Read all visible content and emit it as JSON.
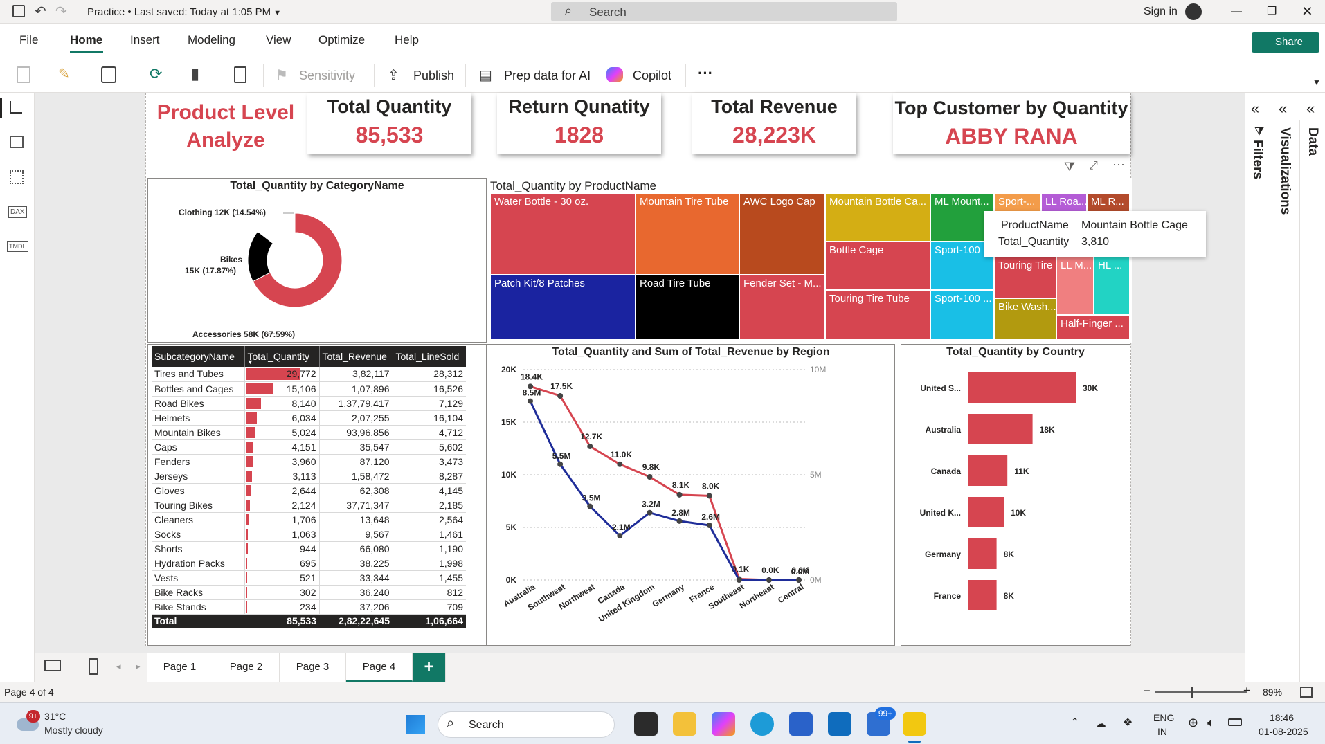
{
  "titlebar": {
    "file_name": "Practice",
    "saved_status": "Last saved: Today at 1:05 PM",
    "search_placeholder": "Search",
    "sign_in": "Sign in"
  },
  "menu": {
    "items": [
      "File",
      "Home",
      "Insert",
      "Modeling",
      "View",
      "Optimize",
      "Help"
    ],
    "active": "Home",
    "share_label": "Share"
  },
  "ribbon": {
    "sensitivity": "Sensitivity",
    "publish": "Publish",
    "prep_data": "Prep data for AI",
    "copilot": "Copilot",
    "more": "···"
  },
  "panes": {
    "filters": "Filters",
    "visualizations": "Visualizations",
    "data": "Data"
  },
  "report": {
    "title_line1": "Product Level",
    "title_line2": "Analyze",
    "kpis": [
      {
        "title": "Total Quantity",
        "value": "85,533"
      },
      {
        "title": "Return Qunatity",
        "value": "1828"
      },
      {
        "title": "Total Revenue",
        "value": "28,223K"
      },
      {
        "title": "Top Customer by Quantity",
        "value": "ABBY RANA"
      }
    ]
  },
  "donut": {
    "title": "Total_Quantity by CategoryName",
    "labels": [
      "Clothing 12K (14.54%)",
      "Bikes",
      "15K (17.87%)",
      "Accessories 58K (67.59%)"
    ],
    "chart_data": {
      "type": "pie",
      "categories": [
        "Accessories",
        "Bikes",
        "Clothing"
      ],
      "values": [
        67.59,
        17.87,
        14.54
      ],
      "colors": [
        "#d64550",
        "#000000",
        "#ffffff"
      ]
    }
  },
  "treemap": {
    "title": "Total_Quantity by ProductName",
    "tiles": [
      "Water Bottle - 30 oz.",
      "Mountain Tire Tube",
      "AWC Logo Cap",
      "Mountain Bottle Ca...",
      "ML Mount...",
      "Sport-...",
      "LL Roa...",
      "ML R...",
      "Patch Kit/8 Patches",
      "Road Tire Tube",
      "Fender Set - M...",
      "Bottle Cage",
      "Sport-100 ...",
      "Touring Tire",
      "LL M...",
      "HL ...",
      "Touring Tire Tube",
      "Sport-100 ...",
      "Bike Wash...",
      "Half-Finger ..."
    ],
    "tooltip": {
      "k1": "ProductName",
      "v1": "Mountain Bottle Cage",
      "k2": "Total_Quantity",
      "v2": "3,810"
    }
  },
  "matrix": {
    "headers": [
      "SubcategoryName",
      "Total_Quantity",
      "Total_Revenue",
      "Total_LineSold"
    ],
    "rows": [
      [
        "Tires and Tubes",
        "29,772",
        "3,82,117",
        "28,312"
      ],
      [
        "Bottles and Cages",
        "15,106",
        "1,07,896",
        "16,526"
      ],
      [
        "Road Bikes",
        "8,140",
        "1,37,79,417",
        "7,129"
      ],
      [
        "Helmets",
        "6,034",
        "2,07,255",
        "16,104"
      ],
      [
        "Mountain Bikes",
        "5,024",
        "93,96,856",
        "4,712"
      ],
      [
        "Caps",
        "4,151",
        "35,547",
        "5,602"
      ],
      [
        "Fenders",
        "3,960",
        "87,120",
        "3,473"
      ],
      [
        "Jerseys",
        "3,113",
        "1,58,472",
        "8,287"
      ],
      [
        "Gloves",
        "2,644",
        "62,308",
        "4,145"
      ],
      [
        "Touring Bikes",
        "2,124",
        "37,71,347",
        "2,185"
      ],
      [
        "Cleaners",
        "1,706",
        "13,648",
        "2,564"
      ],
      [
        "Socks",
        "1,063",
        "9,567",
        "1,461"
      ],
      [
        "Shorts",
        "944",
        "66,080",
        "1,190"
      ],
      [
        "Hydration Packs",
        "695",
        "38,225",
        "1,998"
      ],
      [
        "Vests",
        "521",
        "33,344",
        "1,455"
      ],
      [
        "Bike Racks",
        "302",
        "36,240",
        "812"
      ],
      [
        "Bike Stands",
        "234",
        "37,206",
        "709"
      ]
    ],
    "total": [
      "Total",
      "85,533",
      "2,82,22,645",
      "1,06,664"
    ],
    "quantities": [
      29772,
      15106,
      8140,
      6034,
      5024,
      4151,
      3960,
      3113,
      2644,
      2124,
      1706,
      1063,
      944,
      695,
      521,
      302,
      234
    ]
  },
  "region_chart": {
    "title": "Total_Quantity and Sum of Total_Revenue by Region",
    "chart_data": {
      "type": "line",
      "categories": [
        "Australia",
        "Southwest",
        "Northwest",
        "Canada",
        "United Kingdom",
        "Germany",
        "France",
        "Southeast",
        "Northeast",
        "Central"
      ],
      "series": [
        {
          "name": "Total_Quantity",
          "axis": "left",
          "color": "#d64550",
          "values": [
            18.4,
            17.5,
            12.7,
            11.0,
            9.8,
            8.1,
            8.0,
            0.1,
            0.0,
            0.0
          ],
          "labels": [
            "18.4K",
            "17.5K",
            "12.7K",
            "11.0K",
            "9.8K",
            "8.1K",
            "8.0K",
            "0.1K",
            "0.0K",
            "0.0K"
          ]
        },
        {
          "name": "Sum of Total_Revenue",
          "axis": "right",
          "color": "#1f2d99",
          "values": [
            8.5,
            5.5,
            3.5,
            2.1,
            3.2,
            2.8,
            2.6,
            0.0,
            0.0,
            0.0
          ],
          "labels": [
            "8.5M",
            "5.5M",
            "3.5M",
            "2.1M",
            "3.2M",
            "2.8M",
            "2.6M",
            "",
            "",
            "0.0M"
          ]
        }
      ],
      "left_ticks": [
        "0K",
        "5K",
        "10K",
        "15K",
        "20K"
      ],
      "right_ticks": [
        "0M",
        "5M",
        "10M"
      ],
      "ylim_left": [
        0,
        20
      ],
      "ylim_right": [
        0,
        10
      ]
    }
  },
  "country_chart": {
    "title": "Total_Quantity by Country",
    "chart_data": {
      "type": "bar",
      "categories": [
        "United S...",
        "Australia",
        "Canada",
        "United K...",
        "Germany",
        "France"
      ],
      "values": [
        30,
        18,
        11,
        10,
        8,
        8
      ],
      "labels": [
        "30K",
        "18K",
        "11K",
        "10K",
        "8K",
        "8K"
      ],
      "color": "#d64550"
    }
  },
  "pages": {
    "tabs": [
      "Page 1",
      "Page 2",
      "Page 3",
      "Page 4"
    ],
    "active": "Page 4",
    "add": "+"
  },
  "status": {
    "page_info": "Page 4 of 4",
    "zoom": "89%"
  },
  "taskbar": {
    "temperature": "31°C",
    "weather": "Mostly cloudy",
    "weather_badge": "9+",
    "search": "Search",
    "lang1": "ENG",
    "lang2": "IN",
    "time": "18:46",
    "date": "01-08-2025",
    "badge": "99+"
  }
}
